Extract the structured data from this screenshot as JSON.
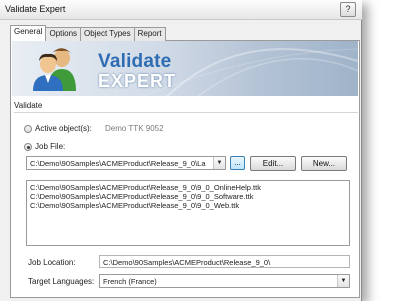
{
  "window": {
    "title": "Validate Expert",
    "help_glyph": "?"
  },
  "tabs": [
    {
      "label": "General",
      "active": true
    },
    {
      "label": "Options",
      "active": false
    },
    {
      "label": "Object Types",
      "active": false
    },
    {
      "label": "Report",
      "active": false
    }
  ],
  "banner": {
    "logo_line1": "Validate",
    "logo_line2": "EXPERT"
  },
  "validate_section": {
    "label": "Validate",
    "active_objects": {
      "label": "Active object(s):",
      "value": "Demo TTK 9052",
      "selected": false
    },
    "job_file": {
      "label": "Job File:",
      "selected": true,
      "path": "C:\\Demo\\90Samples\\ACMEProduct\\Release_9_0\\La",
      "browse_label": "...",
      "edit_label": "Edit...",
      "new_label": "New..."
    },
    "files": [
      "C:\\Demo\\90Samples\\ACMEProduct\\Release_9_0\\9_0_OnlineHelp.ttk",
      "C:\\Demo\\90Samples\\ACMEProduct\\Release_9_0\\9_0_Software.ttk",
      "C:\\Demo\\90Samples\\ACMEProduct\\Release_9_0\\9_0_Web.ttk"
    ],
    "job_location": {
      "label": "Job Location:",
      "value": "C:\\Demo\\90Samples\\ACMEProduct\\Release_9_0\\"
    },
    "target_languages": {
      "label": "Target Languages:",
      "value": "French (France)"
    }
  },
  "colors": {
    "accent_blue": "#2e6db3",
    "button_blue": "#bee6fd"
  },
  "icons": {
    "dropdown": "chevron-down-icon",
    "logo": "people-icon"
  }
}
